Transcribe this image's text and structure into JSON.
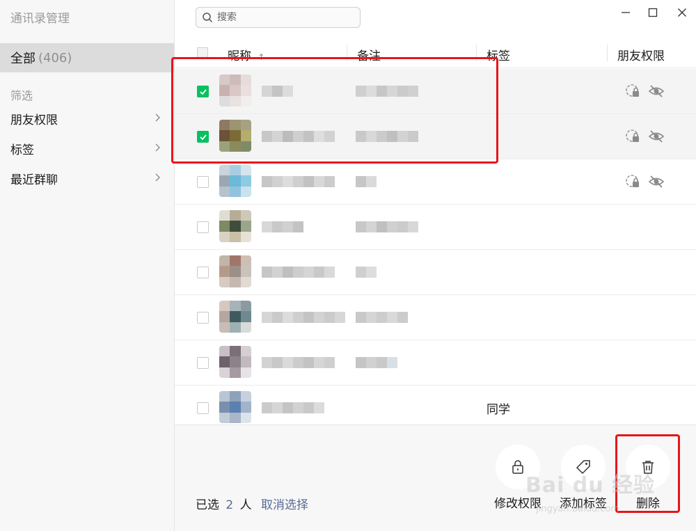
{
  "sidebar": {
    "title": "通讯录管理",
    "all_label": "全部",
    "all_count": "(406)",
    "filter_label": "筛选",
    "items": [
      {
        "label": "朋友权限"
      },
      {
        "label": "标签"
      },
      {
        "label": "最近群聊"
      }
    ]
  },
  "search": {
    "placeholder": "搜索"
  },
  "table": {
    "columns": {
      "nickname": "昵称",
      "sort_arrow": "↑",
      "remark": "备注",
      "tag": "标签",
      "permission": "朋友权限"
    },
    "rows": [
      {
        "checked": true,
        "tag": "",
        "perm_icons": true
      },
      {
        "checked": true,
        "tag": "",
        "perm_icons": true
      },
      {
        "checked": false,
        "tag": "",
        "perm_icons": true
      },
      {
        "checked": false,
        "tag": "",
        "perm_icons": false
      },
      {
        "checked": false,
        "tag": "",
        "perm_icons": false
      },
      {
        "checked": false,
        "tag": "",
        "perm_icons": false
      },
      {
        "checked": false,
        "tag": "",
        "perm_icons": false
      },
      {
        "checked": false,
        "tag": "同学",
        "perm_icons": false
      }
    ]
  },
  "footer": {
    "selected_prefix": "已选",
    "selected_count": "2",
    "selected_suffix": "人",
    "cancel_label": "取消选择",
    "actions": {
      "modify_permission": "修改权限",
      "add_tag": "添加标签",
      "delete": "删除"
    }
  },
  "watermark": {
    "text": "Bai du 经验",
    "sub": "jingyan.baidu.com"
  },
  "colors": {
    "accent_green": "#07c160",
    "link_blue": "#576b95",
    "highlight_red": "#e8141b"
  }
}
